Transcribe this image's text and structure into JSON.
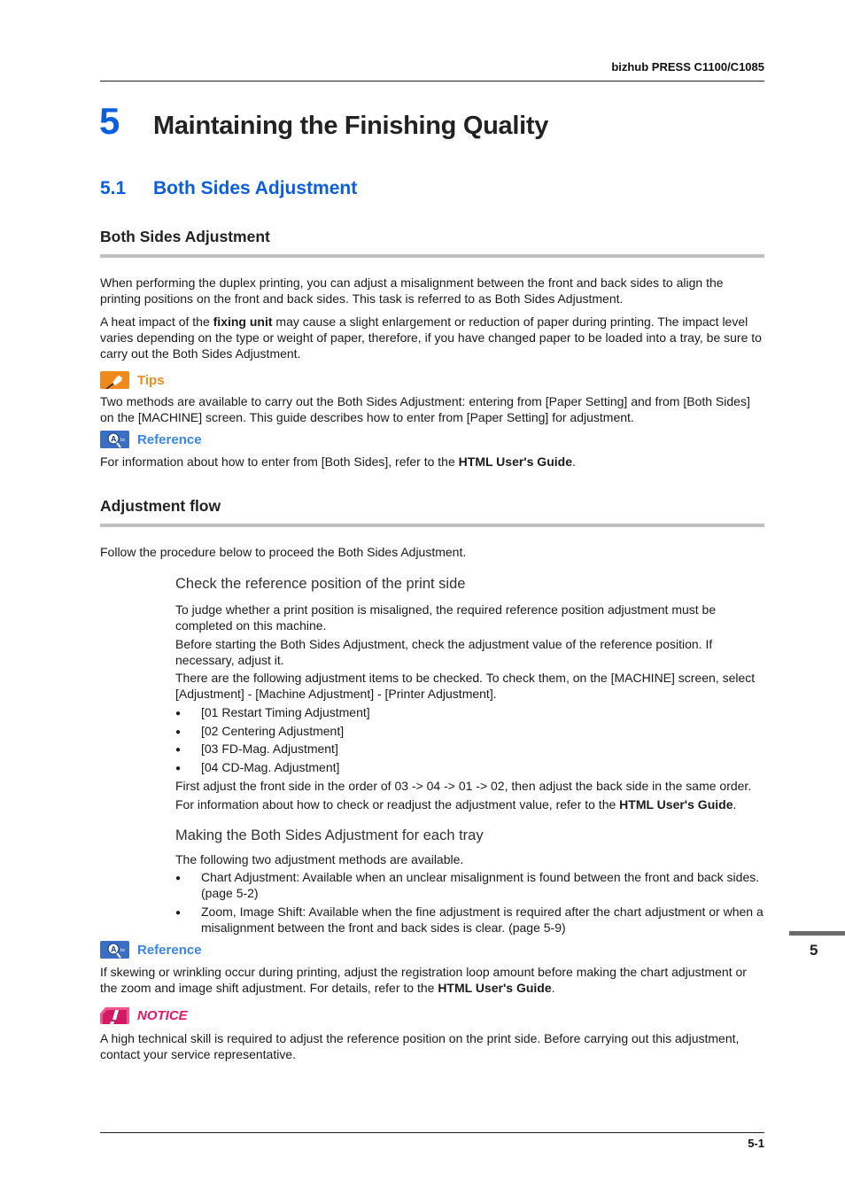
{
  "header": {
    "product": "bizhub PRESS C1100/C1085"
  },
  "chapter": {
    "number": "5",
    "title": "Maintaining the Finishing Quality"
  },
  "section": {
    "number": "5.1",
    "title": "Both Sides Adjustment"
  },
  "subsection1": {
    "title": "Both Sides Adjustment",
    "para1": "When performing the duplex printing, you can adjust a misalignment between the front and back sides to align the printing positions on the front and back sides. This task is referred to as Both Sides Adjustment.",
    "para2_pre": "A heat impact of the ",
    "para2_bold": "fixing unit",
    "para2_post": " may cause a slight enlargement or reduction of paper during printing. The impact level varies depending on the type or weight of paper, therefore, if you have changed paper to be loaded into a tray, be sure to carry out the Both Sides Adjustment.",
    "tips": {
      "label": "Tips",
      "icon": "pushpin-icon",
      "text": "Two methods are available to carry out the Both Sides Adjustment: entering from [Paper Setting] and from [Both Sides] on the [MACHINE] screen. This guide describes how to enter from [Paper Setting] for adjustment."
    },
    "reference": {
      "label": "Reference",
      "icon": "magnifier-icon",
      "text_pre": "For information about how to enter from [Both Sides], refer to the ",
      "text_bold": "HTML User's Guide",
      "text_post": "."
    }
  },
  "subsection2": {
    "title": "Adjustment flow",
    "intro": "Follow the procedure below to proceed the Both Sides Adjustment.",
    "step1": {
      "title": "Check the reference position of the print side",
      "p1": "To judge whether a print position is misaligned, the required reference position adjustment must be completed on this machine.",
      "p2": "Before starting the Both Sides Adjustment, check the adjustment value of the reference position. If necessary, adjust it.",
      "p3": "There are the following adjustment items to be checked. To check them, on the [MACHINE] screen, select [Adjustment] - [Machine Adjustment] - [Printer Adjustment].",
      "items": [
        "[01 Restart Timing Adjustment]",
        "[02 Centering Adjustment]",
        "[03 FD-Mag. Adjustment]",
        "[04 CD-Mag. Adjustment]"
      ],
      "p4": "First adjust the front side in the order of 03 -> 04 -> 01 -> 02, then adjust the back side in the same order.",
      "p5_pre": "For information about how to check or readjust the adjustment value, refer to the ",
      "p5_bold": "HTML User's Guide",
      "p5_post": "."
    },
    "step2": {
      "title": "Making the Both Sides Adjustment for each tray",
      "p1": "The following two adjustment methods are available.",
      "items": [
        "Chart Adjustment: Available when an unclear misalignment is found between the front and back sides. (page 5-2)",
        "Zoom, Image Shift: Available when the fine adjustment is required after the chart adjustment or when a misalignment between the front and back sides is clear. (page 5-9)"
      ]
    },
    "reference": {
      "label": "Reference",
      "icon": "magnifier-icon",
      "text_pre": "If skewing or wrinkling occur during printing, adjust the registration loop amount before making the chart adjustment or the zoom and image shift adjustment. For details, refer to the ",
      "text_bold": "HTML User's Guide",
      "text_post": "."
    },
    "notice": {
      "label": "NOTICE",
      "icon": "exclamation-icon",
      "text": "A high technical skill is required to adjust the reference position on the print side. Before carrying out this adjustment, contact your service representative."
    }
  },
  "side_tab": {
    "chapter": "5"
  },
  "footer": {
    "page": "5-1"
  },
  "colors": {
    "accent_blue": "#0a5fe0",
    "tips_orange": "#f08a1c",
    "reference_blue": "#3a86e8",
    "notice_magenta": "#e5156b"
  }
}
